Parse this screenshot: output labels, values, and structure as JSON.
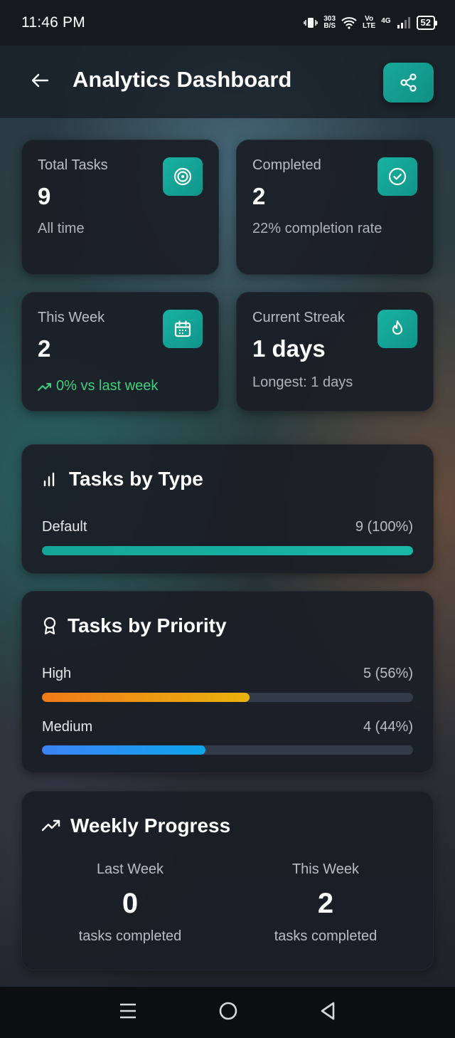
{
  "status_bar": {
    "time": "11:46 PM",
    "net_speed_top": "303",
    "net_speed_bottom": "B/S",
    "volte_top": "Vo",
    "volte_bottom": "LTE",
    "network": "4G",
    "battery": "52"
  },
  "header": {
    "title": "Analytics Dashboard"
  },
  "stats": {
    "total": {
      "label": "Total Tasks",
      "value": "9",
      "sub": "All time",
      "icon": "target-icon"
    },
    "completed": {
      "label": "Completed",
      "value": "2",
      "sub": "22% completion rate",
      "icon": "check-circle-icon"
    },
    "week": {
      "label": "This Week",
      "value": "2",
      "trend": "0% vs last week",
      "icon": "calendar-icon"
    },
    "streak": {
      "label": "Current Streak",
      "value": "1 days",
      "sub": "Longest: 1 days",
      "icon": "flame-icon"
    }
  },
  "by_type": {
    "title": "Tasks by Type",
    "rows": [
      {
        "label": "Default",
        "value": "9 (100%)",
        "fraction": 1.0
      }
    ]
  },
  "by_priority": {
    "title": "Tasks by Priority",
    "rows": [
      {
        "label": "High",
        "value": "5 (56%)",
        "fraction": 0.56
      },
      {
        "label": "Medium",
        "value": "4 (44%)",
        "fraction": 0.44
      }
    ]
  },
  "weekly": {
    "title": "Weekly Progress",
    "last": {
      "label": "Last Week",
      "value": "0",
      "sub": "tasks completed"
    },
    "this": {
      "label": "This Week",
      "value": "2",
      "sub": "tasks completed"
    }
  },
  "colors": {
    "accent": "#14a596",
    "trend_green": "#3ecf7d",
    "high_start": "#f07a1a",
    "high_end": "#eab30c",
    "medium_start": "#3b82f6",
    "medium_end": "#0ea5e9"
  }
}
